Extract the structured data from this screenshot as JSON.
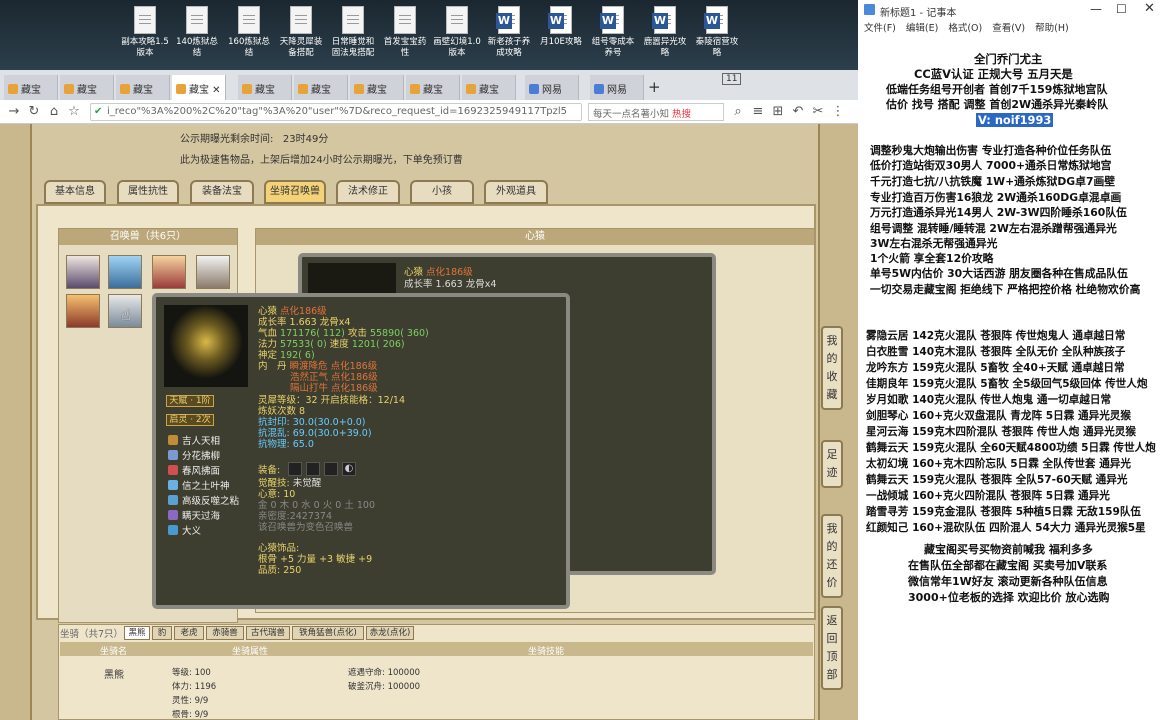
{
  "desktop": {
    "icons": [
      {
        "label": "副本攻略1.5版本",
        "word": false
      },
      {
        "label": "140炼狱总结",
        "word": false
      },
      {
        "label": "160炼狱总结",
        "word": false
      },
      {
        "label": "天降灵犀装备搭配",
        "word": false
      },
      {
        "label": "日常睡觉和固法鬼搭配",
        "word": false
      },
      {
        "label": "首发宝宝药性",
        "word": false
      },
      {
        "label": "画壁幻境1.0版本",
        "word": false
      },
      {
        "label": "新老孩子养成攻略",
        "word": true
      },
      {
        "label": "月10E攻略",
        "word": true
      },
      {
        "label": "组号零成本养号",
        "word": true
      },
      {
        "label": "鹿嚣异光攻略",
        "word": true
      },
      {
        "label": "秦陵宿营攻略",
        "word": true
      }
    ]
  },
  "browser": {
    "tabs": [
      "藏宝",
      "藏宝",
      "藏宝",
      "藏宝",
      "藏宝",
      "藏宝",
      "藏宝",
      "藏宝",
      "藏宝",
      "网易",
      "网易"
    ],
    "tab_count": "11",
    "url": "i_reco\"%3A%200%2C%20\"tag\"%3A%20\"user\"%7D&reco_request_id=1692325949117Tpzl5",
    "search_text": "每天一点名著小知",
    "search_hot": "热搜"
  },
  "page": {
    "public_time_label": "公示期曝光剩余时间:",
    "public_time_value": "23时49分",
    "notice": "此为极速售物品，上架后增加24小时公示期曝光，下单免预订曹",
    "tabs": [
      "基本信息",
      "属性抗性",
      "装备法宝",
      "坐骑召唤兽",
      "法术修正",
      "小孩",
      "外观道具"
    ],
    "active_tab": "坐骑召唤兽",
    "pet_panel_title": "召唤兽（共6只）",
    "right_panel_title": "心猿",
    "side_buttons": [
      "我的收藏",
      "足迹",
      "我的还价",
      "返回顶部"
    ]
  },
  "tooltip_back": {
    "name": "心猿",
    "tag": "点化186级",
    "growth": "成长率 1.663 龙骨x4"
  },
  "tooltip": {
    "name": "心猿",
    "tag": "点化186级",
    "growth": "成长率 1.663 龙骨x4",
    "qixue_label": "气血",
    "qixue": "171176( 112)",
    "attack_label": "攻击",
    "attack": "55890( 360)",
    "fali_label": "法力",
    "fali": "57533( 0)",
    "speed_label": "速度",
    "speed": "1201( 206)",
    "lingxing_label": "神定",
    "lingxing": "192( 6)",
    "inner_label": "内　丹",
    "inner1": "瞬渡降危 点化186级",
    "inner2": "浩然正气 点化186级",
    "inner3": "隔山打牛 点化186级",
    "soul_level": "灵犀等级：32 开启技能格：12/14",
    "refine": "炼妖次数 8",
    "resist1": "抗封印: 30.0(30.0+0.0)",
    "resist2": "抗混乱: 69.0(30.0+39.0)",
    "resist3": "抗物理: 65.0",
    "tianfu": "天赋 · 1阶",
    "qiling": "启灵 · 2次",
    "skills": [
      "吉人天相",
      "分花拂柳",
      "春风拂面",
      "信之土叶神",
      "高级反噬之粘",
      "瞒天过海",
      "大义"
    ],
    "equip_label": "装备:",
    "awaken_label": "觉醒技:",
    "awaken_value": "未觉醒",
    "heart_label": "心意:",
    "heart_value": "10",
    "elements": "金 0 木 0 水 0 火 0 土 100",
    "intimacy": "亲密度:2427374",
    "transform": "该召唤兽为变色召唤兽",
    "decor_title": "心猿饰品:",
    "decor_stats": "根骨 +5 力量 +3 敏捷 +9",
    "decor_quality": "品质:  250"
  },
  "mount": {
    "title": "坐骑（共7只）",
    "tabs": [
      "黑熊",
      "豹",
      "老虎",
      "赤骑兽",
      "古代瑞兽",
      "铁角猛兽(点化)",
      "赤龙(点化)"
    ],
    "col_name": "坐骑名",
    "col_attr": "坐骑属性",
    "col_skill": "坐骑技能",
    "name": "黑熊",
    "attrs": [
      "等级: 100",
      "体力: 1196",
      "灵性: 9/9",
      "根骨: 9/9"
    ],
    "skill_lines": [
      "遮遇守命:  100000",
      "破釜沉舟:  100000"
    ]
  },
  "notepad": {
    "title": "新标题1 - 记事本",
    "menu": [
      "文件(F)",
      "编辑(E)",
      "格式(O)",
      "查看(V)",
      "帮助(H)"
    ],
    "lines": [
      "全门乔门尤主",
      "CC蓝V认证  正规大号  五月天是",
      "低端任务组号开创者             首创7千159炼狱地宫队",
      "估价 找号 搭配 调整             首创2W通杀异光秦岭队",
      "V:  noif1993",
      "调整秒鬼大炮输出伤害             专业打造各种价位任务队伍",
      "低价打造站街双30男人             7000+通杀日常炼狱地宫",
      "千元打造七抗/八抗铁魔             1W+通杀炼狱DG卓7画壁",
      "专业打造百万伤害16狼龙             2W通杀160DG卓混卓画",
      "万元打造通杀异光14男人           2W-3W四阶睡杀160队伍",
      "组号调整 混转睡/睡转混           2W左右混杀蹭帮强通异光",
      "                               3W左右混杀无帮强通异光",
      "1个火箭 享全套12价攻略",
      "单号5W内估价 30大话西游           朋友圈各种在售成品队伍",
      "一切交易走藏宝阁 拒绝线下     严格把控价格 杜绝物欢价高",
      "雾隐云居 142克火混队 苍狠阵 传世炮鬼人 通卓越日常",
      "白衣胜雪 140克木混队 苍狠阵 全队无价 全队种族孩子",
      "龙吟东方 159克火混队 5畜牧 全40+天赋 通卓越日常",
      "佳期良年 159克火混队 5畜牧 全5级回气5级回体 传世人炮",
      "岁月如歌 140克火混队 传世人炮鬼 通一切卓越日常",
      "剑胆琴心 160+克火双盘混队 青龙阵 5日霖 通异光灵猴",
      "星河云海 159克木四阶混队 苍狠阵 传世人炮 通异光灵猴",
      "鹤舞云天 159克火混队 全60天赋4800功绩 5日霖 传世人炮",
      "太初幻境 160+克木四阶忘队 5日霖 全队传世套 通异光",
      "鹤舞云天 159克火混队 苍狠阵 全队57-60天赋 通异光",
      "一战倾城 160+克火四阶混队 苍狠阵 5日霖 通异光",
      "踏雪寻芳 159克金混队 苍狠阵 5种植5日霖 无敌159队伍",
      "红颜知己 160+混砍队伍 四阶混人 54大力 通异光灵猴5星",
      "藏宝阁买号买物资前喊我 福利多多",
      "在售队伍全部都在藏宝阁 买卖号加V联系",
      "微信常年1W好友 滚动更新各种队伍信息",
      "3000+位老板的选择 欢迎比价 放心选购"
    ]
  },
  "colors": {
    "accent_orange": "#e0743a",
    "green_stat": "#7ed061",
    "gold": "#e8d36a",
    "highlight": "#2b67c4"
  }
}
